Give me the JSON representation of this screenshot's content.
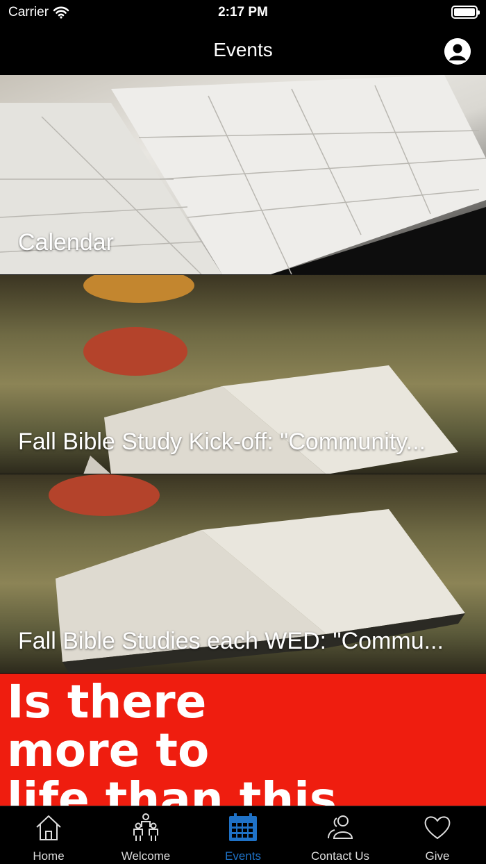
{
  "status_bar": {
    "carrier": "Carrier",
    "time": "2:17 PM"
  },
  "nav": {
    "title": "Events",
    "profile_icon": "person-circle-icon"
  },
  "events": [
    {
      "title": "Calendar"
    },
    {
      "title": "Fall Bible Study Kick-off: \"Community..."
    },
    {
      "title": "Fall Bible Studies each WED: \"Commu..."
    },
    {
      "title": "",
      "image_text": [
        "Is there",
        "more to",
        "life than this"
      ]
    }
  ],
  "tabs": [
    {
      "label": "Home",
      "icon": "home-icon",
      "active": false
    },
    {
      "label": "Welcome",
      "icon": "people-icon",
      "active": false
    },
    {
      "label": "Events",
      "icon": "calendar-icon",
      "active": true
    },
    {
      "label": "Contact Us",
      "icon": "contacts-icon",
      "active": false
    },
    {
      "label": "Give",
      "icon": "heart-icon",
      "active": false
    }
  ],
  "colors": {
    "accent": "#1f72c7",
    "bar_background": "#000000",
    "promo_red": "#ef1d0f"
  }
}
